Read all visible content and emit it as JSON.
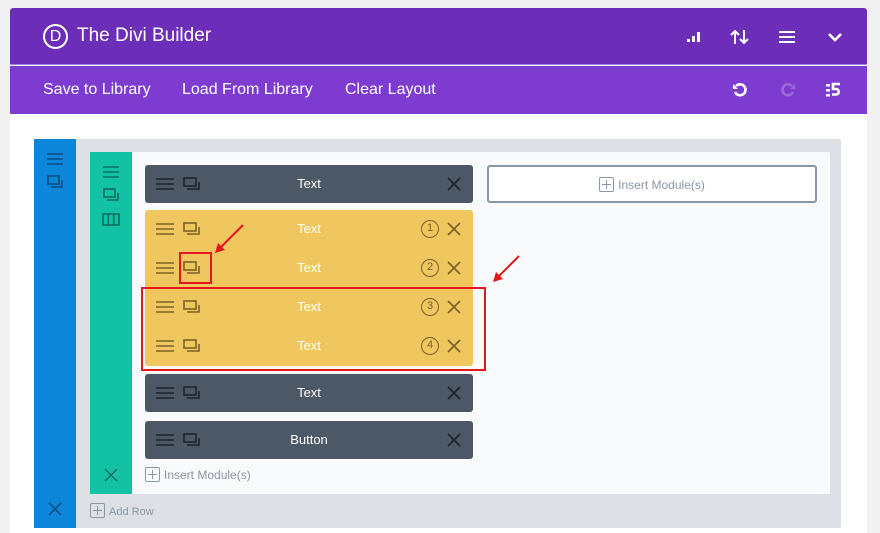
{
  "header": {
    "logo_letter": "D",
    "title": "The Divi Builder",
    "icons": [
      "portability-bars-icon",
      "sort-arrows-icon",
      "hamburger-menu-icon",
      "chevron-down-icon"
    ]
  },
  "toolbar": {
    "save_label": "Save to Library",
    "load_label": "Load From Library",
    "clear_label": "Clear Layout",
    "icons": [
      "undo-icon",
      "redo-icon",
      "history-icon"
    ]
  },
  "section": {
    "icons": [
      "move-handle-icon",
      "duplicate-icon",
      "delete-icon"
    ],
    "add_row_label": "Add Row",
    "row": {
      "icons": [
        "move-handle-icon",
        "duplicate-icon",
        "columns-icon",
        "delete-icon"
      ],
      "column1": {
        "modules": [
          {
            "label": "Text",
            "style": "dark"
          },
          {
            "label": "Text",
            "style": "selected",
            "number": "1"
          },
          {
            "label": "Text",
            "style": "selected",
            "number": "2"
          },
          {
            "label": "Text",
            "style": "selected",
            "number": "3"
          },
          {
            "label": "Text",
            "style": "selected",
            "number": "4"
          },
          {
            "label": "Text",
            "style": "dark"
          },
          {
            "label": "Button",
            "style": "dark"
          }
        ],
        "insert_label": "Insert Module(s)"
      },
      "column2": {
        "insert_label": "Insert Module(s)"
      }
    }
  },
  "colors": {
    "header_bg": "#6c2eb9",
    "toolbar_bg": "#7e3bd0",
    "section_bar": "#0b86d9",
    "row_bar": "#13c1a4",
    "module_dark": "#4c5866",
    "module_selected": "#efc75e",
    "annotation_red": "#e3171c"
  }
}
